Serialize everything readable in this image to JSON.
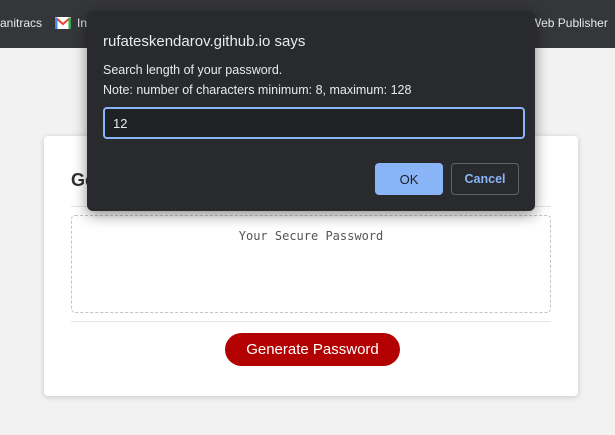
{
  "bookmarks": [
    {
      "label": "anitracs"
    },
    {
      "label": "In",
      "icon": "gmail-icon"
    },
    {
      "label": "Web Publisher"
    }
  ],
  "card": {
    "title_fragment": "Ge",
    "password_placeholder": "Your Secure Password",
    "generate_button_label": "Generate Password"
  },
  "dialog": {
    "title": "rufateskendarov.github.io says",
    "message_line1": "Search length of your password.",
    "message_line2": "Note: number of characters minimum: 8, maximum: 128",
    "input_value": "12",
    "ok_label": "OK",
    "cancel_label": "Cancel"
  },
  "colors": {
    "accent_button": "#b30000",
    "dialog_bg": "#292a2d",
    "dialog_accent": "#8ab4f8"
  }
}
